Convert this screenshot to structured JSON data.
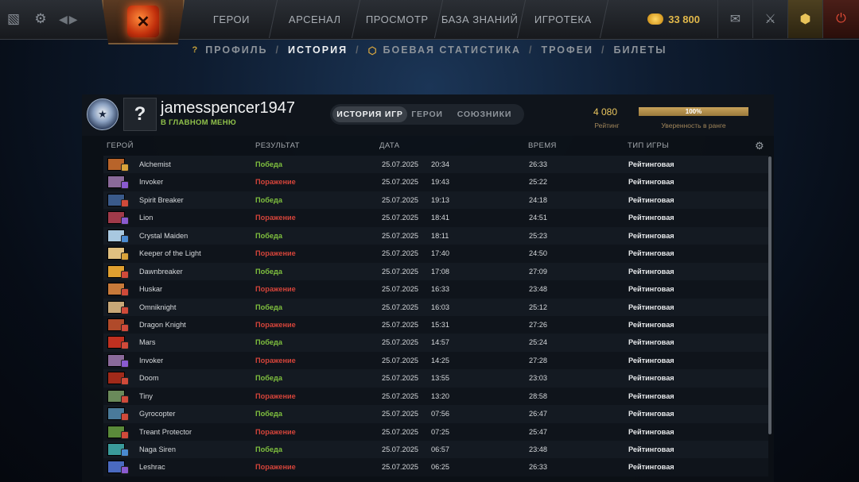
{
  "topbar": {
    "left_icons": [
      "dashboard-icon",
      "gear-icon"
    ],
    "logo": "dota-logo",
    "nav": [
      "ГЕРОИ",
      "АРСЕНАЛ",
      "ПРОСМОТР",
      "БАЗА ЗНАНИЙ",
      "ИГРОТЕКА"
    ],
    "coins": "33 800",
    "accent": "#e0b74a",
    "right_icons": [
      "chat-icon",
      "items-icon",
      "plus-level-icon",
      "power-icon"
    ]
  },
  "subnav": {
    "items": [
      "ПРОФИЛЬ",
      "ИСТОРИЯ",
      "БОЕВАЯ СТАТИСТИКА",
      "ТРОФЕИ",
      "БИЛЕТЫ"
    ],
    "active": "ИСТОРИЯ"
  },
  "profile": {
    "username": "jamesspencer1947",
    "status": "В ГЛАВНОМ МЕНЮ",
    "tabs": [
      "ИСТОРИЯ ИГР",
      "ГЕРОИ",
      "СОЮЗНИКИ"
    ],
    "active_tab": "ИСТОРИЯ ИГР",
    "rating_value": "4 080",
    "rating_label": "Рейтинг",
    "confidence_value": "100%",
    "confidence_fraction": 1.0,
    "confidence_label": "Уверенность в ранге"
  },
  "table": {
    "headers": [
      "ГЕРОЙ",
      "РЕЗУЛЬТАТ",
      "ДАТА",
      "ВРЕМЯ",
      "ТИП ИГРЫ"
    ],
    "colors": {
      "win": "#7fc03e",
      "loss": "#d4443a"
    },
    "rows": [
      {
        "hero": "Alchemist",
        "result": "Победа",
        "win": true,
        "date": "25.07.2025",
        "time": "20:34",
        "duration": "26:33",
        "type": "Рейтинговая",
        "hero_color": "#b8642a",
        "attr_color": "#d8a23a"
      },
      {
        "hero": "Invoker",
        "result": "Поражение",
        "win": false,
        "date": "25.07.2025",
        "time": "19:43",
        "duration": "25:22",
        "type": "Рейтинговая",
        "hero_color": "#8a6a9a",
        "attr_color": "#8a5ad0"
      },
      {
        "hero": "Spirit Breaker",
        "result": "Победа",
        "win": true,
        "date": "25.07.2025",
        "time": "19:13",
        "duration": "24:18",
        "type": "Рейтинговая",
        "hero_color": "#3a5a8a",
        "attr_color": "#d04a3a"
      },
      {
        "hero": "Lion",
        "result": "Поражение",
        "win": false,
        "date": "25.07.2025",
        "time": "18:41",
        "duration": "24:51",
        "type": "Рейтинговая",
        "hero_color": "#a03a4a",
        "attr_color": "#8a5ad0"
      },
      {
        "hero": "Crystal Maiden",
        "result": "Победа",
        "win": true,
        "date": "25.07.2025",
        "time": "18:11",
        "duration": "25:23",
        "type": "Рейтинговая",
        "hero_color": "#a8c8e0",
        "attr_color": "#4a8ad0"
      },
      {
        "hero": "Keeper of the Light",
        "result": "Поражение",
        "win": false,
        "date": "25.07.2025",
        "time": "17:40",
        "duration": "24:50",
        "type": "Рейтинговая",
        "hero_color": "#e0c080",
        "attr_color": "#d8a23a"
      },
      {
        "hero": "Dawnbreaker",
        "result": "Победа",
        "win": true,
        "date": "25.07.2025",
        "time": "17:08",
        "duration": "27:09",
        "type": "Рейтинговая",
        "hero_color": "#e0a030",
        "attr_color": "#d04a3a"
      },
      {
        "hero": "Huskar",
        "result": "Поражение",
        "win": false,
        "date": "25.07.2025",
        "time": "16:33",
        "duration": "23:48",
        "type": "Рейтинговая",
        "hero_color": "#c87a3a",
        "attr_color": "#d04a3a"
      },
      {
        "hero": "Omniknight",
        "result": "Победа",
        "win": true,
        "date": "25.07.2025",
        "time": "16:03",
        "duration": "25:12",
        "type": "Рейтинговая",
        "hero_color": "#c8a878",
        "attr_color": "#d04a3a"
      },
      {
        "hero": "Dragon Knight",
        "result": "Поражение",
        "win": false,
        "date": "25.07.2025",
        "time": "15:31",
        "duration": "27:26",
        "type": "Рейтинговая",
        "hero_color": "#b04a2a",
        "attr_color": "#d04a3a"
      },
      {
        "hero": "Mars",
        "result": "Победа",
        "win": true,
        "date": "25.07.2025",
        "time": "14:57",
        "duration": "25:24",
        "type": "Рейтинговая",
        "hero_color": "#c03020",
        "attr_color": "#d04a3a"
      },
      {
        "hero": "Invoker",
        "result": "Поражение",
        "win": false,
        "date": "25.07.2025",
        "time": "14:25",
        "duration": "27:28",
        "type": "Рейтинговая",
        "hero_color": "#8a6a9a",
        "attr_color": "#8a5ad0"
      },
      {
        "hero": "Doom",
        "result": "Победа",
        "win": true,
        "date": "25.07.2025",
        "time": "13:55",
        "duration": "23:03",
        "type": "Рейтинговая",
        "hero_color": "#a02a1a",
        "attr_color": "#d04a3a"
      },
      {
        "hero": "Tiny",
        "result": "Поражение",
        "win": false,
        "date": "25.07.2025",
        "time": "13:20",
        "duration": "28:58",
        "type": "Рейтинговая",
        "hero_color": "#6a8a5a",
        "attr_color": "#d04a3a"
      },
      {
        "hero": "Gyrocopter",
        "result": "Победа",
        "win": true,
        "date": "25.07.2025",
        "time": "07:56",
        "duration": "26:47",
        "type": "Рейтинговая",
        "hero_color": "#4a7a9a",
        "attr_color": "#d04a3a"
      },
      {
        "hero": "Treant Protector",
        "result": "Поражение",
        "win": false,
        "date": "25.07.2025",
        "time": "07:25",
        "duration": "25:47",
        "type": "Рейтинговая",
        "hero_color": "#5a8a3a",
        "attr_color": "#d04a3a"
      },
      {
        "hero": "Naga Siren",
        "result": "Победа",
        "win": true,
        "date": "25.07.2025",
        "time": "06:57",
        "duration": "23:48",
        "type": "Рейтинговая",
        "hero_color": "#3a9a9a",
        "attr_color": "#4a8ad0"
      },
      {
        "hero": "Leshrac",
        "result": "Поражение",
        "win": false,
        "date": "25.07.2025",
        "time": "06:25",
        "duration": "26:33",
        "type": "Рейтинговая",
        "hero_color": "#4a6ac0",
        "attr_color": "#8a5ad0"
      }
    ]
  }
}
